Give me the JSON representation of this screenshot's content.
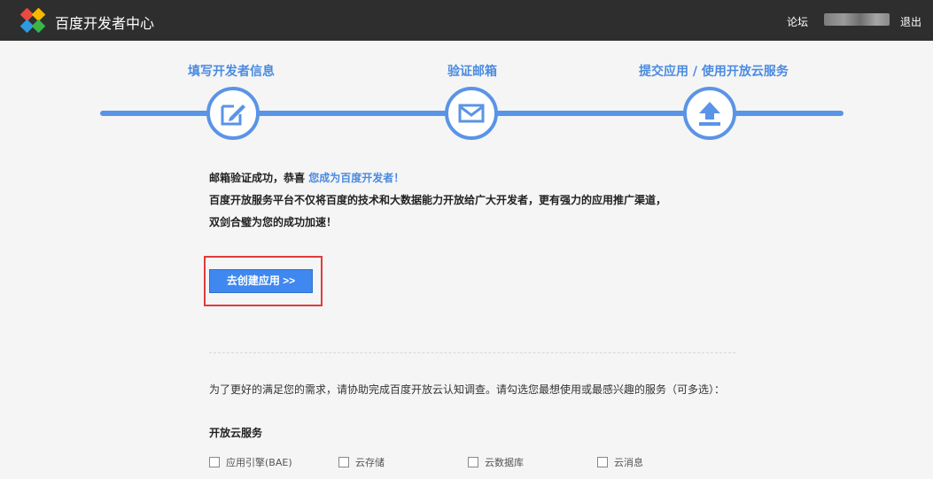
{
  "header": {
    "brand": "百度开发者中心",
    "nav_forum": "论坛",
    "nav_logout": "退出",
    "colors": {
      "background": "#2e2e2e",
      "text": "#ffffff"
    }
  },
  "steps": [
    {
      "label": "填写开发者信息",
      "icon": "edit-icon"
    },
    {
      "label": "验证邮箱",
      "icon": "envelope-icon"
    },
    {
      "label": "提交应用 / 使用开放云服务",
      "icon": "upload-icon"
    }
  ],
  "message": {
    "line1_prefix": "邮箱验证成功，恭喜",
    "line1_highlight": "您成为百度开发者！",
    "line2": "百度开放服务平台不仅将百度的技术和大数据能力开放给广大开发者，更有强力的应用推广渠道，",
    "line3": "双剑合璧为您的成功加速！"
  },
  "create_button": "去创建应用 >>",
  "survey": {
    "text": "为了更好的满足您的需求，请协助完成百度开放云认知调查。请勾选您最想使用或最感兴趣的服务（可多选）：",
    "section_title": "开放云服务",
    "options": [
      "应用引擎(BAE)",
      "云存储",
      "云数据库",
      "云消息"
    ]
  },
  "colors": {
    "accent": "#5a94e6",
    "button": "#3e88f0",
    "highlight_border": "#e03c3c"
  }
}
